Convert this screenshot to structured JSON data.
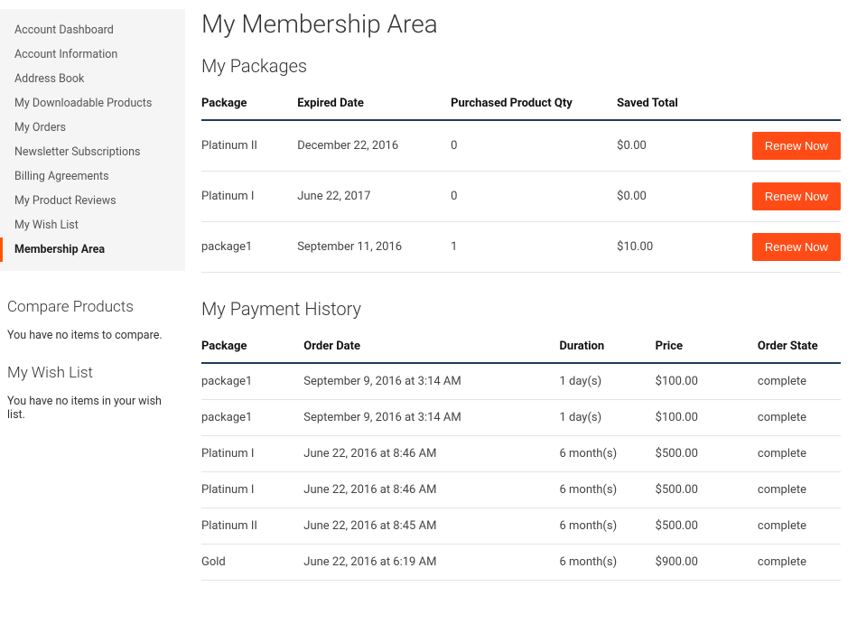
{
  "sidebar": {
    "nav": [
      {
        "label": "Account Dashboard",
        "active": false
      },
      {
        "label": "Account Information",
        "active": false
      },
      {
        "label": "Address Book",
        "active": false
      },
      {
        "label": "My Downloadable Products",
        "active": false
      },
      {
        "label": "My Orders",
        "active": false
      },
      {
        "label": "Newsletter Subscriptions",
        "active": false
      },
      {
        "label": "Billing Agreements",
        "active": false
      },
      {
        "label": "My Product Reviews",
        "active": false
      },
      {
        "label": "My Wish List",
        "active": false
      },
      {
        "label": "Membership Area",
        "active": true
      }
    ],
    "compare": {
      "heading": "Compare Products",
      "text": "You have no items to compare."
    },
    "wishlist": {
      "heading": "My Wish List",
      "text": "You have no items in your wish list."
    }
  },
  "page": {
    "title": "My Membership Area"
  },
  "packages": {
    "heading": "My Packages",
    "columns": {
      "c1": "Package",
      "c2": "Expired Date",
      "c3": "Purchased Product Qty",
      "c4": "Saved Total"
    },
    "renew_label": "Renew Now",
    "rows": [
      {
        "package": "Platinum II",
        "expired": "December 22, 2016",
        "qty": "0",
        "saved": "$0.00"
      },
      {
        "package": "Platinum I",
        "expired": "June 22, 2017",
        "qty": "0",
        "saved": "$0.00"
      },
      {
        "package": "package1",
        "expired": "September 11, 2016",
        "qty": "1",
        "saved": "$10.00"
      }
    ]
  },
  "history": {
    "heading": "My Payment History",
    "columns": {
      "c1": "Package",
      "c2": "Order Date",
      "c3": "Duration",
      "c4": "Price",
      "c5": "Order State"
    },
    "rows": [
      {
        "package": "package1",
        "date": "September 9, 2016 at 3:14 AM",
        "duration": "1 day(s)",
        "price": "$100.00",
        "state": "complete"
      },
      {
        "package": "package1",
        "date": "September 9, 2016 at 3:14 AM",
        "duration": "1 day(s)",
        "price": "$100.00",
        "state": "complete"
      },
      {
        "package": "Platinum I",
        "date": "June 22, 2016 at 8:46 AM",
        "duration": "6 month(s)",
        "price": "$500.00",
        "state": "complete"
      },
      {
        "package": "Platinum I",
        "date": "June 22, 2016 at 8:46 AM",
        "duration": "6 month(s)",
        "price": "$500.00",
        "state": "complete"
      },
      {
        "package": "Platinum II",
        "date": "June 22, 2016 at 8:45 AM",
        "duration": "6 month(s)",
        "price": "$500.00",
        "state": "complete"
      },
      {
        "package": "Gold",
        "date": "June 22, 2016 at 6:19 AM",
        "duration": "6 month(s)",
        "price": "$900.00",
        "state": "complete"
      }
    ]
  }
}
